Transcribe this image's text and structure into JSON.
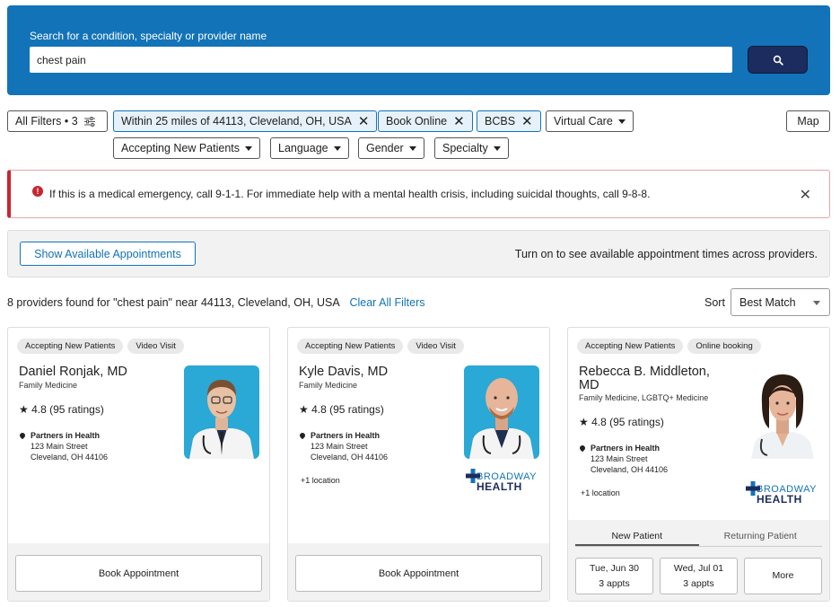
{
  "search": {
    "label": "Search for a condition, specialty or provider name",
    "value": "chest pain",
    "button_icon": "search-icon"
  },
  "filters": {
    "all_filters_label": "All Filters • 3",
    "active": [
      {
        "label": "Within 25 miles of 44113, Cleveland, OH, USA"
      },
      {
        "label": "Book Online"
      },
      {
        "label": "BCBS"
      }
    ],
    "dropdowns": [
      "Virtual Care",
      "Accepting New Patients",
      "Language",
      "Gender",
      "Specialty"
    ],
    "map_label": "Map"
  },
  "alert": {
    "text": "If this is a medical emergency, call 9-1-1. For immediate help with a mental health crisis, including suicidal thoughts, call 9-8-8.",
    "color": "#c9252f"
  },
  "appointments": {
    "button_label": "Show Available Appointments",
    "hint": "Turn on to see available appointment times across providers."
  },
  "results": {
    "summary": "8 providers found for \"chest pain\" near 44113, Cleveland, OH, USA",
    "clear_label": "Clear All Filters",
    "sort_label": "Sort",
    "sort_value": "Best Match"
  },
  "providers": [
    {
      "tags": [
        "Accepting New Patients",
        "Video Visit"
      ],
      "name": "Daniel Ronjak, MD",
      "specialty": "Family Medicine",
      "rating": "4.8 (95 ratings)",
      "org": "Partners in Health",
      "street": "123 Main Street",
      "city": "Cleveland, OH 44106",
      "book_label": "Book Appointment"
    },
    {
      "tags": [
        "Accepting New Patients",
        "Video Visit"
      ],
      "name": "Kyle Davis, MD",
      "specialty": "Family Medicine",
      "rating": "4.8 (95 ratings)",
      "org": "Partners in Health",
      "street": "123 Main Street",
      "city": "Cleveland, OH 44106",
      "more_locations": "+1 location",
      "brand_top": "BROADWAY",
      "brand_bottom": "HEALTH",
      "book_label": "Book Appointment"
    },
    {
      "tags": [
        "Accepting New Patients",
        "Online booking"
      ],
      "name": "Rebecca B. Middleton, MD",
      "specialty": "Family Medicine, LGBTQ+ Medicine",
      "rating": "4.8 (95 ratings)",
      "org": "Partners in Health",
      "street": "123 Main Street",
      "city": "Cleveland, OH 44106",
      "more_locations": "+1 location",
      "brand_top": "BROADWAY",
      "brand_bottom": "HEALTH",
      "tabs": [
        "New Patient",
        "Returning Patient"
      ],
      "slots": [
        {
          "day": "Tue, Jun 30",
          "count": "3 appts"
        },
        {
          "day": "Wed, Jul 01",
          "count": "3 appts"
        }
      ],
      "more_label": "More"
    }
  ],
  "colors": {
    "brand_blue": "#1373b8",
    "navy": "#1c2c5e",
    "photo_bg": "#2aa8d6"
  }
}
